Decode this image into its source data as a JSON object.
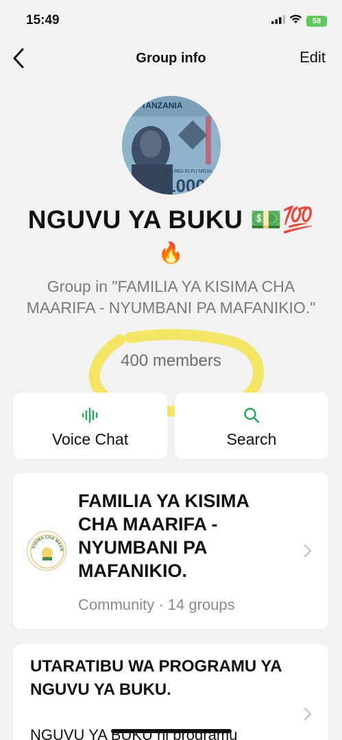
{
  "status_bar": {
    "time": "15:49",
    "battery": "58"
  },
  "nav": {
    "title": "Group info",
    "edit_label": "Edit"
  },
  "group": {
    "name": "NGUVU YA BUKU 💵💯",
    "name_line2": "🔥",
    "description": "Group in \"FAMILIA YA KISIMA CHA MAARIFA - NYUMBANI PA MAFANIKIO.\"",
    "members": "400 members"
  },
  "avatar_text": {
    "country": "TANZANIA",
    "denomination": "1000",
    "caption": "SHILINGI ELFU MOJA"
  },
  "actions": [
    {
      "label": "Voice Chat",
      "icon": "waveform-icon"
    },
    {
      "label": "Search",
      "icon": "search-icon"
    }
  ],
  "community": {
    "title": "FAMILIA YA KISIMA CHA MAARIFA - NYUMBANI PA MAFANIKIO.",
    "subtitle": "Community · 14 groups",
    "logo_text": "KISIMA CHA MAARIFA"
  },
  "rules": {
    "title": "UTARATIBU WA PROGRAMU YA NGUVU YA BUKU.",
    "body": "NGUVU YA BUKU ni programu"
  },
  "colors": {
    "accent": "#1fa855",
    "highlight": "#f3e33a",
    "background": "#f2f2f2"
  }
}
